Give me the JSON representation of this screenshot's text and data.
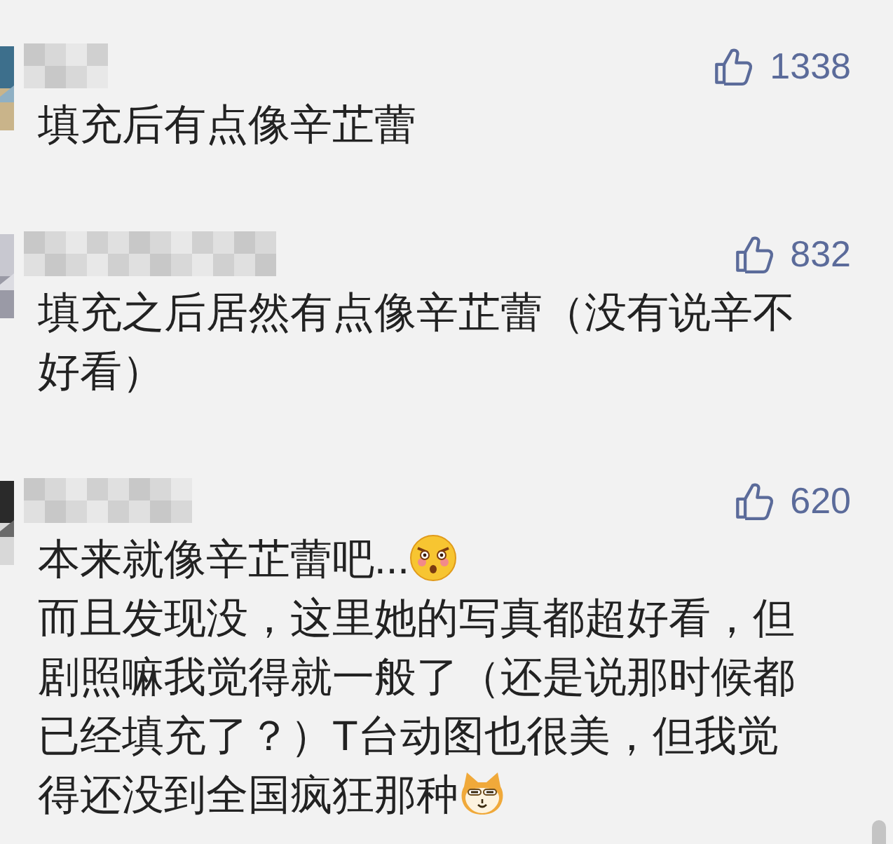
{
  "comments": [
    {
      "likes": "1338",
      "lines": [
        {
          "text": "填充后有点像辛芷蕾"
        }
      ]
    },
    {
      "likes": "832",
      "lines": [
        {
          "text": "填充之后居然有点像辛芷蕾（没有说辛不"
        },
        {
          "text": "好看）"
        }
      ]
    },
    {
      "likes": "620",
      "lines": [
        {
          "text": "本来就像辛芷蕾吧...",
          "icon": {
            "kind": "shocked"
          }
        },
        {
          "text": "而且发现没，这里她的写真都超好看，但"
        },
        {
          "text": "剧照嘛我觉得就一般了（还是说那时候都"
        },
        {
          "text": "已经填充了？）T台动图也很美，但我觉"
        },
        {
          "text": "得还没到全国疯狂那种",
          "icon": {
            "kind": "dog"
          }
        }
      ]
    }
  ]
}
